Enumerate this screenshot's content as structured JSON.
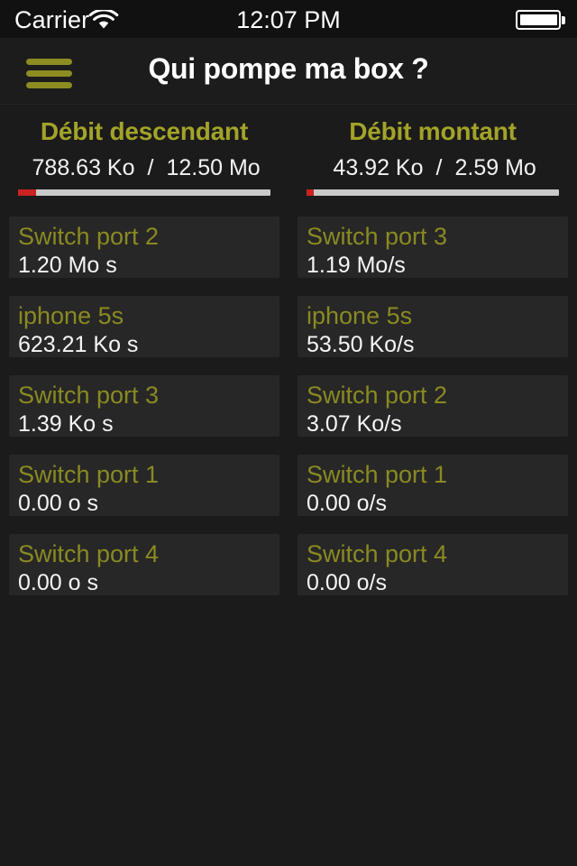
{
  "status_bar": {
    "carrier": "Carrier",
    "wifi_icon": "wifi-icon",
    "time": "12:07 PM",
    "battery_icon": "battery-full-icon"
  },
  "nav": {
    "menu_icon": "hamburger-menu-icon",
    "title": "Qui pompe ma box ?"
  },
  "colors": {
    "accent": "#a3a329",
    "card_accent": "#8a8a22",
    "progress_fill": "#cc2222",
    "progress_track": "#c9c9c9",
    "background": "#1b1b1b",
    "card_background": "#272727"
  },
  "stats": {
    "download": {
      "title": "Débit descendant",
      "current": "788.63 Ko",
      "separator": "/",
      "total": "12.50 Mo",
      "progress_percent": 7
    },
    "upload": {
      "title": "Débit montant",
      "current": "43.92 Ko",
      "separator": "/",
      "total": "2.59 Mo",
      "progress_percent": 3
    }
  },
  "download_list": [
    {
      "name": "Switch port 2",
      "rate": "1.20 Mo s"
    },
    {
      "name": "iphone 5s",
      "rate": "623.21 Ko s"
    },
    {
      "name": "Switch port 3",
      "rate": "1.39 Ko s"
    },
    {
      "name": "Switch port 1",
      "rate": "0.00 o s"
    },
    {
      "name": "Switch port 4",
      "rate": "0.00 o s"
    }
  ],
  "upload_list": [
    {
      "name": "Switch port 3",
      "rate": "1.19 Mo/s"
    },
    {
      "name": "iphone 5s",
      "rate": "53.50 Ko/s"
    },
    {
      "name": "Switch port 2",
      "rate": "3.07 Ko/s"
    },
    {
      "name": "Switch port 1",
      "rate": "0.00 o/s"
    },
    {
      "name": "Switch port 4",
      "rate": "0.00 o/s"
    }
  ]
}
